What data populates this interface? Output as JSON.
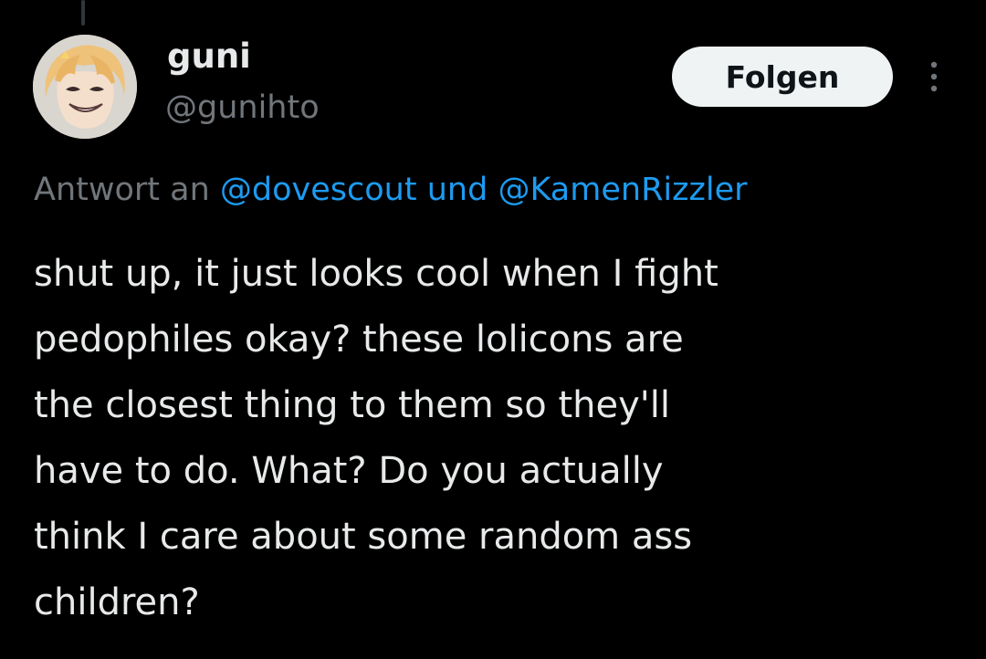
{
  "colors": {
    "background": "#000000",
    "text_primary": "#e7e9ea",
    "text_secondary": "#71767b",
    "mention_blue": "#1d9bf0",
    "follow_button_bg": "#eff3f4"
  },
  "header": {
    "display_name": "guni",
    "handle": "@gunihto",
    "follow_label": "Folgen",
    "avatar_icon": "anime-avatar-icon",
    "more_icon": "more-vertical-icon"
  },
  "reply": {
    "prefix": "Antwort an",
    "mention_1": "@dovescout",
    "joiner": "und",
    "mention_2": "@KamenRizzler"
  },
  "tweet": {
    "text": "shut up, it just looks cool when I fight\npedophiles okay? these lolicons are\nthe closest thing to them so they'll\nhave to do. What? Do you actually\nthink I care about some random ass\nchildren?"
  }
}
